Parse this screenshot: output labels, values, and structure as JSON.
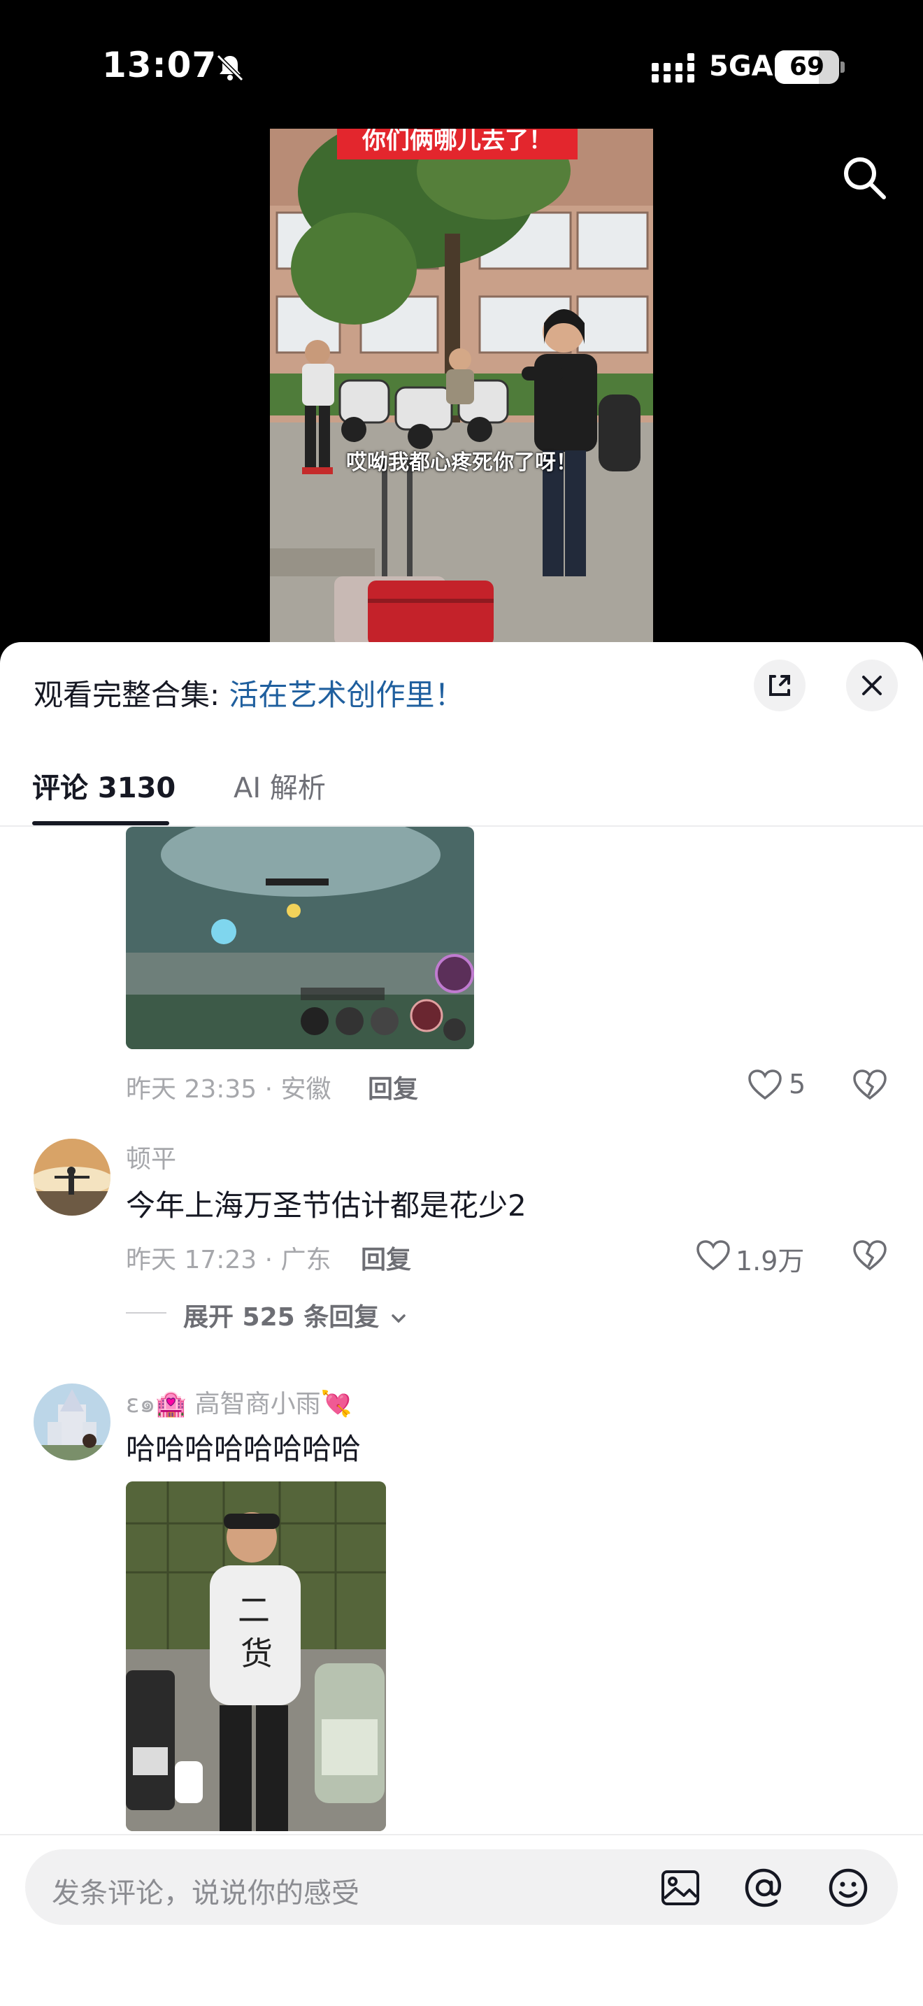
{
  "status": {
    "time": "13:07",
    "network": "5GA",
    "battery": "69",
    "battery_level": 0.69
  },
  "video": {
    "caption_top": "你们俩哪儿去了！",
    "subtitle": "哎呦我都心疼死你了呀！"
  },
  "collection": {
    "prefix": "观看完整合集: ",
    "link": "活在艺术创作里！"
  },
  "tabs": {
    "comments": "评论 3130",
    "ai": "AI 解析"
  },
  "comments": [
    {
      "meta": "昨天 23:35 · 安徽",
      "reply": "回复",
      "likes": "5"
    },
    {
      "user": "顿平",
      "text": "今年上海万圣节估计都是花少2",
      "meta": "昨天 17:23 · 广东",
      "reply": "回复",
      "likes": "1.9万",
      "expand": "展开 525 条回复"
    },
    {
      "user": "ɛ๑🏩 高智商小雨💘",
      "text": "哈哈哈哈哈哈哈哈"
    }
  ],
  "input": {
    "placeholder": "发条评论，说说你的感受"
  },
  "icons": [
    "bell-slash-icon",
    "signal-icon",
    "search-icon",
    "expand-icon",
    "close-icon",
    "heart-icon",
    "broken-heart-icon",
    "chevron-down-icon",
    "image-icon",
    "at-icon",
    "emoji-icon"
  ]
}
